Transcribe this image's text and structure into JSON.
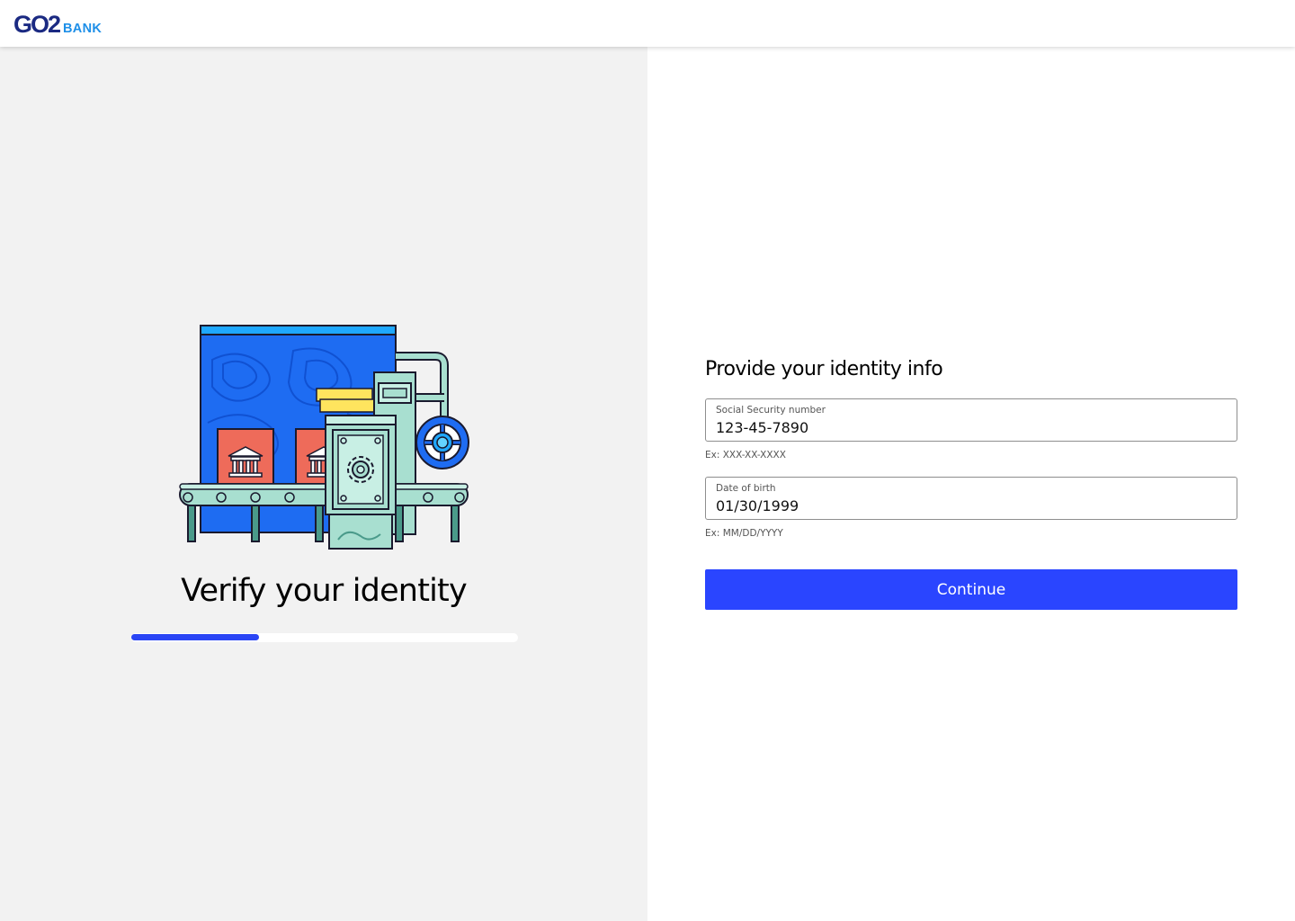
{
  "brand": {
    "logo_main": "GO2",
    "logo_sub": "BANK"
  },
  "hero": {
    "title": "Verify your identity",
    "progress_fraction": 0.33,
    "illustration": "identity-verification-factory-illustration"
  },
  "form": {
    "title": "Provide your identity info",
    "ssn": {
      "label": "Social Security number",
      "value": "123-45-7890",
      "hint": "Ex: XXX-XX-XXXX"
    },
    "dob": {
      "label": "Date of birth",
      "value": "01/30/1999",
      "hint": "Ex: MM/DD/YYYY"
    },
    "continue_label": "Continue"
  },
  "colors": {
    "accent": "#2a45ff",
    "brand_dark": "#1b2a82",
    "brand_light": "#1e8fe8",
    "panel_bg": "#f2f2f2"
  }
}
